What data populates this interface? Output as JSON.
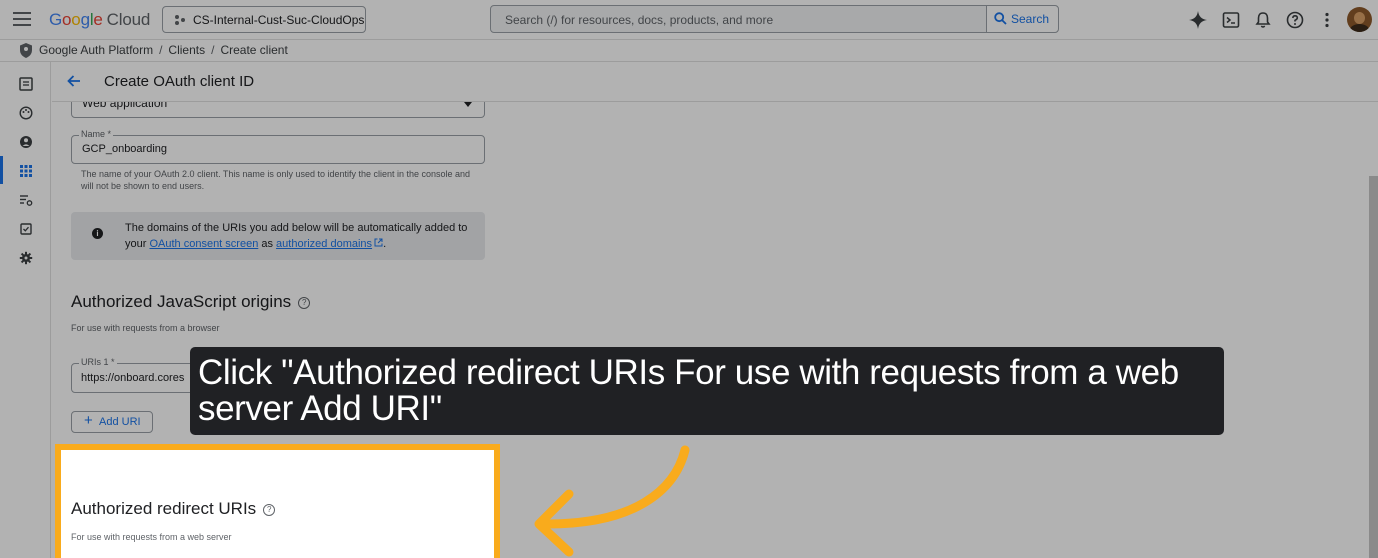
{
  "header": {
    "logo": {
      "google": "Google",
      "cloud": "Cloud"
    },
    "project": "CS-Internal-Cust-Suc-CloudOps",
    "search_placeholder": "Search (/) for resources, docs, products, and more",
    "search_button": "Search"
  },
  "breadcrumb": [
    "Google Auth Platform",
    "Clients",
    "Create client"
  ],
  "page_title": "Create OAuth client ID",
  "form": {
    "app_type_value": "Web application",
    "name_label": "Name *",
    "name_value": "GCP_onboarding",
    "name_help": "The name of your OAuth 2.0 client. This name is only used to identify the client in the console and will not be shown to end users.",
    "info": {
      "text_1": "The domains of the URIs you add below will be automatically added to your ",
      "link_1": "OAuth consent screen",
      "text_2": " as ",
      "link_2": "authorized domains",
      "text_3": "."
    },
    "js_origins": {
      "title": "Authorized JavaScript origins",
      "subtitle": "For use with requests from a browser",
      "uri_label": "URIs 1 *",
      "uri_value": "https://onboard.cores",
      "add_button": "Add URI"
    },
    "redirect": {
      "title": "Authorized redirect URIs",
      "subtitle": "For use with requests from a web server"
    }
  },
  "tooltip": "Click \"Authorized redirect URIs  For use with requests from a web server  Add URI\"",
  "colors": {
    "accent": "#1a73e8",
    "highlight": "#f9ab1c",
    "tooltip_bg": "#202124"
  }
}
